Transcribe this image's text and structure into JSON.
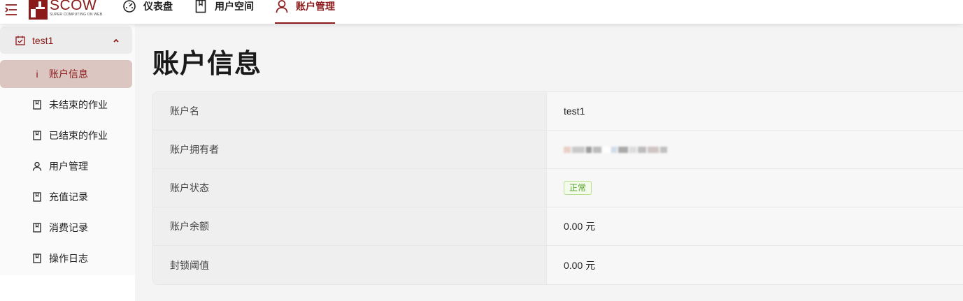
{
  "header": {
    "logo_title": "SCOW",
    "logo_subtitle": "SUPER COMPUTING ON WEB",
    "nav": [
      {
        "label": "仪表盘",
        "icon": "dashboard-icon"
      },
      {
        "label": "用户空间",
        "icon": "book-icon"
      },
      {
        "label": "账户管理",
        "icon": "user-icon",
        "active": true
      }
    ]
  },
  "sidebar": {
    "group_label": "test1",
    "items": [
      {
        "label": "账户信息",
        "icon": "info-icon",
        "active": true
      },
      {
        "label": "未结束的作业",
        "icon": "book-icon"
      },
      {
        "label": "已结束的作业",
        "icon": "book-icon"
      },
      {
        "label": "用户管理",
        "icon": "user-icon"
      },
      {
        "label": "充值记录",
        "icon": "book-icon"
      },
      {
        "label": "消费记录",
        "icon": "book-icon"
      },
      {
        "label": "操作日志",
        "icon": "book-icon"
      }
    ]
  },
  "main": {
    "title": "账户信息",
    "rows": [
      {
        "label": "账户名",
        "value": "test1"
      },
      {
        "label": "账户拥有者",
        "value": ""
      },
      {
        "label": "账户状态",
        "value": "正常"
      },
      {
        "label": "账户余额",
        "value": "0.00 元"
      },
      {
        "label": "封锁阈值",
        "value": "0.00 元"
      }
    ]
  },
  "colors": {
    "brand": "#8b1a1a",
    "active_bg": "#dcc6c2",
    "status_green": "#52a32a"
  }
}
